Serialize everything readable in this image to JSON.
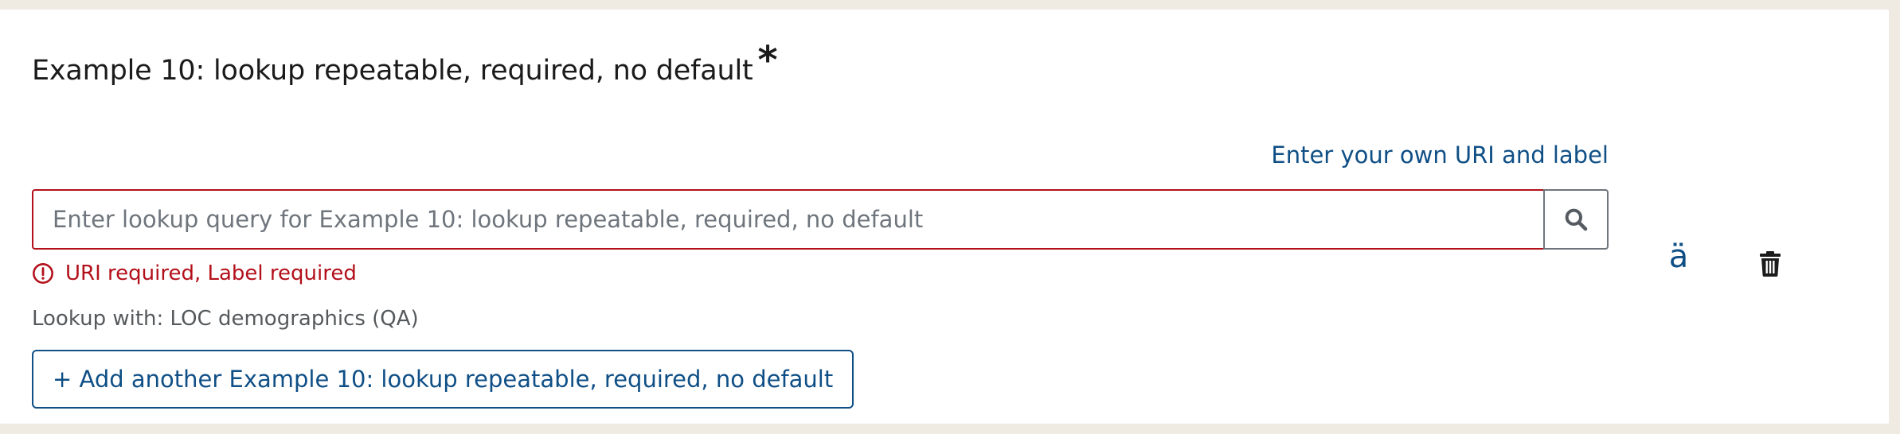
{
  "field": {
    "title": "Example 10: lookup repeatable, required, no default",
    "required_marker": "*"
  },
  "links": {
    "own_uri_label": "Enter your own URI and label"
  },
  "search": {
    "placeholder": "Enter lookup query for Example 10: lookup repeatable, required, no default",
    "value": "",
    "button_icon": "search-icon"
  },
  "validation": {
    "message": "URI required, Label required",
    "icon": "alert-circle-icon"
  },
  "lookup": {
    "source_label": "Lookup with: LOC demographics (QA)"
  },
  "actions": {
    "add_another_label": "+ Add another Example 10: lookup repeatable, required, no default",
    "language_button_glyph": "ä",
    "delete_icon": "trash-icon"
  },
  "colors": {
    "link": "#0f4f86",
    "error": "#b3101a",
    "muted_text": "#55595c",
    "page_background": "#efebe3"
  }
}
